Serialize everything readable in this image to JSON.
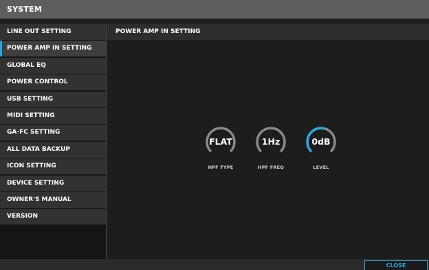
{
  "window": {
    "title": "SYSTEM"
  },
  "sidebar": {
    "items": [
      {
        "label": "LINE OUT SETTING"
      },
      {
        "label": "POWER AMP IN SETTING"
      },
      {
        "label": "GLOBAL EQ"
      },
      {
        "label": "POWER CONTROL"
      },
      {
        "label": "USB SETTING"
      },
      {
        "label": "MIDI SETTING"
      },
      {
        "label": "GA-FC SETTING"
      },
      {
        "label": "ALL DATA BACKUP"
      },
      {
        "label": "ICON SETTING"
      },
      {
        "label": "DEVICE SETTING"
      },
      {
        "label": "OWNER'S MANUAL"
      },
      {
        "label": "VERSION"
      }
    ],
    "active_index": 1
  },
  "main": {
    "title": "POWER AMP IN SETTING",
    "knobs": [
      {
        "value": "FLAT",
        "label": "HPF TYPE",
        "level": 0
      },
      {
        "value": "1Hz",
        "label": "HPF FREQ",
        "level": 0
      },
      {
        "value": "0dB",
        "label": "LEVEL",
        "level": 0.55
      }
    ]
  },
  "footer": {
    "close_label": "CLOSE"
  },
  "colors": {
    "accent": "#2aa8e0",
    "knob_track": "#8a8a8a"
  }
}
